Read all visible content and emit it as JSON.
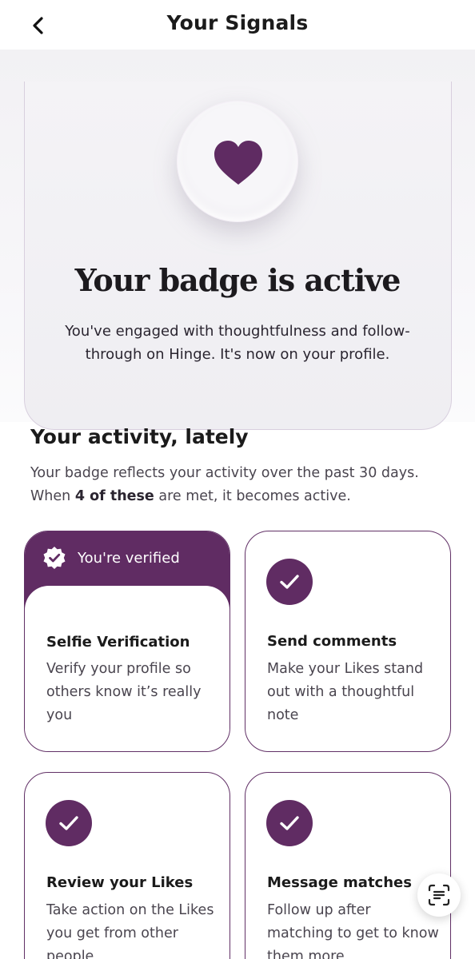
{
  "header": {
    "title": "Your Signals"
  },
  "hero": {
    "title": "Your badge is active",
    "body": "You've engaged with thoughtfulness and follow-through on Hinge. It's now on your profile."
  },
  "activity": {
    "title": "Your activity, lately",
    "desc_before": "Your badge reflects your activity over the past 30 days. When ",
    "desc_bold": "4 of these",
    "desc_after": " are met, it becomes active."
  },
  "cards": [
    {
      "badge": "You're verified",
      "title": "Selfie Verification",
      "body": "Verify your profile so others know it’s really you",
      "status": "verified"
    },
    {
      "title": "Send comments",
      "body": "Make your Likes stand out with a thoughtful note",
      "status": "complete"
    },
    {
      "title": "Review your Likes",
      "body": "Take action on the Likes you get from other people",
      "status": "complete"
    },
    {
      "title": "Message matches",
      "body": "Follow up after matching to get to know them more",
      "status": "complete"
    }
  ],
  "icons": {
    "back": "chevron-left-icon",
    "heart": "heart-icon",
    "verified": "verified-badge-icon",
    "check": "checkmark-icon",
    "scan": "scan-text-icon"
  },
  "colors": {
    "brand_purple": "#602c63",
    "card_border": "#613066",
    "text_dark": "#1b1b1b",
    "text_muted": "#4a454f"
  }
}
